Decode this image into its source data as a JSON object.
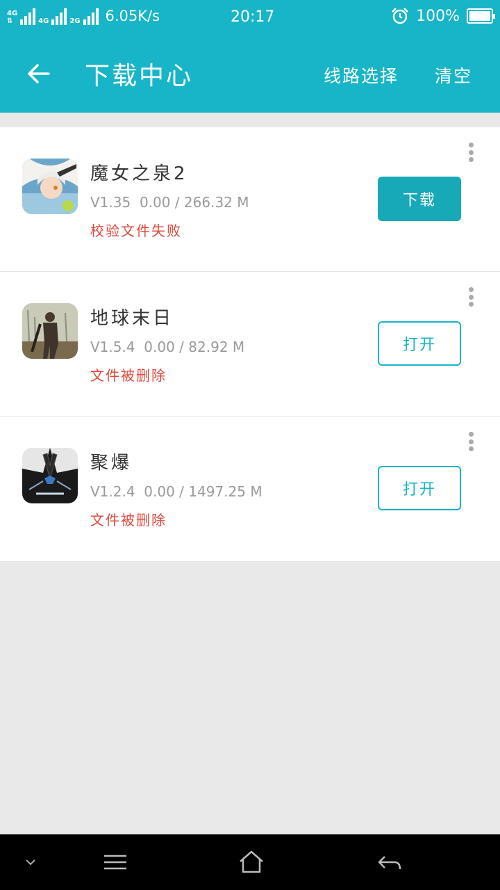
{
  "status_bar": {
    "network_1": "4G",
    "network_2": "4G",
    "network_3": "2G",
    "speed": "6.05K/s",
    "time": "20:17",
    "battery": "100%"
  },
  "appbar": {
    "title": "下载中心",
    "route_label": "线路选择",
    "clear_label": "清空"
  },
  "downloads": [
    {
      "name": "魔女之泉2",
      "version": "V1.35",
      "progress": "0.00 / 266.32 M",
      "status": "校验文件失败",
      "action": "下载",
      "icon": "game-icon-witch-spring"
    },
    {
      "name": "地球末日",
      "version": "V1.5.4",
      "progress": "0.00 / 82.92 M",
      "status": "文件被删除",
      "action": "打开",
      "icon": "game-icon-last-day-on-earth"
    },
    {
      "name": "聚爆",
      "version": "V1.2.4",
      "progress": "0.00 / 1497.25 M",
      "status": "文件被删除",
      "action": "打开",
      "icon": "game-icon-implosion"
    }
  ],
  "colors": {
    "primary": "#17b5c7",
    "button_fill": "#17a9b8",
    "error": "#e0473a",
    "background": "#e9e9e9"
  }
}
